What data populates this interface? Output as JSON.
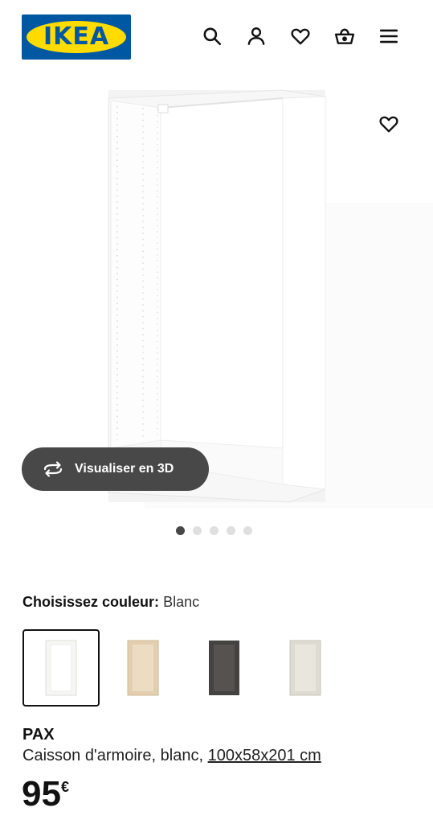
{
  "header": {
    "logo_text": "IKEA",
    "icons": [
      "search-icon",
      "user-icon",
      "heart-icon",
      "basket-icon",
      "menu-icon"
    ]
  },
  "product_image": {
    "favorite_icon": "heart-icon",
    "view_3d_label": "Visualiser en 3D",
    "carousel": {
      "count": 5,
      "active_index": 0
    }
  },
  "color_chooser": {
    "label": "Choisissez couleur:",
    "selected_value": "Blanc",
    "swatch_colors": [
      "#f6f6f4",
      "#e3cfb0",
      "#454340",
      "#dedbd2"
    ]
  },
  "product": {
    "name": "PAX",
    "description_prefix": "Caisson d'armoire, blanc, ",
    "dimensions": "100x58x201 cm",
    "price": "95",
    "currency": "€"
  },
  "colors": {
    "ikea_blue": "#0058A3",
    "ikea_yellow": "#FFDB00",
    "button_dark": "#484848"
  }
}
